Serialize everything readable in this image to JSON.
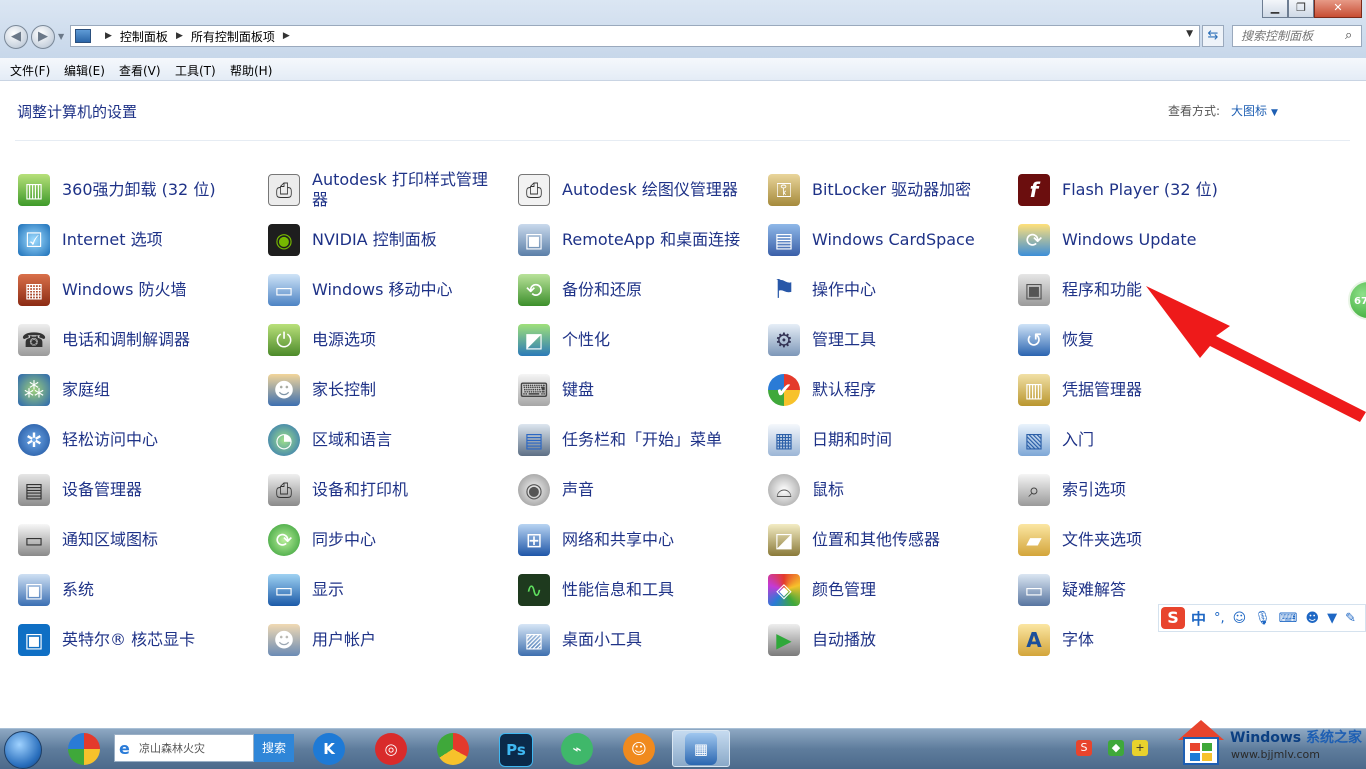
{
  "window": {
    "breadcrumb": [
      "控制面板",
      "所有控制面板项"
    ],
    "search_placeholder": "搜索控制面板",
    "controls": [
      "minimize",
      "maximize",
      "close"
    ]
  },
  "menu": [
    "文件(F)",
    "编辑(E)",
    "查看(V)",
    "工具(T)",
    "帮助(H)"
  ],
  "content": {
    "heading": "调整计算机的设置",
    "view_by_label": "查看方式:",
    "view_by_value": "大图标"
  },
  "items": [
    {
      "label": "360强力卸载 (32 位)",
      "icon": "uninstall-icon"
    },
    {
      "label": "Autodesk 打印样式管理器",
      "icon": "printer-style-icon"
    },
    {
      "label": "Autodesk 绘图仪管理器",
      "icon": "plotter-icon"
    },
    {
      "label": "BitLocker 驱动器加密",
      "icon": "bitlocker-icon"
    },
    {
      "label": "Flash Player (32 位)",
      "icon": "flash-icon"
    },
    {
      "label": "Internet 选项",
      "icon": "internet-options-icon"
    },
    {
      "label": "NVIDIA 控制面板",
      "icon": "nvidia-icon"
    },
    {
      "label": "RemoteApp 和桌面连接",
      "icon": "remoteapp-icon"
    },
    {
      "label": "Windows CardSpace",
      "icon": "cardspace-icon"
    },
    {
      "label": "Windows Update",
      "icon": "windows-update-icon"
    },
    {
      "label": "Windows 防火墙",
      "icon": "firewall-icon"
    },
    {
      "label": "Windows 移动中心",
      "icon": "mobility-center-icon"
    },
    {
      "label": "备份和还原",
      "icon": "backup-icon"
    },
    {
      "label": "操作中心",
      "icon": "action-center-flag-icon"
    },
    {
      "label": "程序和功能",
      "icon": "programs-features-icon"
    },
    {
      "label": "电话和调制解调器",
      "icon": "phone-modem-icon"
    },
    {
      "label": "电源选项",
      "icon": "power-icon"
    },
    {
      "label": "个性化",
      "icon": "personalization-icon"
    },
    {
      "label": "管理工具",
      "icon": "admin-tools-icon"
    },
    {
      "label": "恢复",
      "icon": "recovery-icon"
    },
    {
      "label": "家庭组",
      "icon": "homegroup-icon"
    },
    {
      "label": "家长控制",
      "icon": "parental-control-icon"
    },
    {
      "label": "键盘",
      "icon": "keyboard-icon"
    },
    {
      "label": "默认程序",
      "icon": "default-programs-icon"
    },
    {
      "label": "凭据管理器",
      "icon": "credential-manager-icon"
    },
    {
      "label": "轻松访问中心",
      "icon": "ease-of-access-icon"
    },
    {
      "label": "区域和语言",
      "icon": "region-language-icon"
    },
    {
      "label": "任务栏和「开始」菜单",
      "icon": "taskbar-start-icon"
    },
    {
      "label": "日期和时间",
      "icon": "date-time-icon"
    },
    {
      "label": "入门",
      "icon": "getting-started-icon"
    },
    {
      "label": "设备管理器",
      "icon": "device-manager-icon"
    },
    {
      "label": "设备和打印机",
      "icon": "devices-printers-icon"
    },
    {
      "label": "声音",
      "icon": "sound-icon"
    },
    {
      "label": "鼠标",
      "icon": "mouse-icon"
    },
    {
      "label": "索引选项",
      "icon": "indexing-icon"
    },
    {
      "label": "通知区域图标",
      "icon": "notification-area-icon"
    },
    {
      "label": "同步中心",
      "icon": "sync-center-icon"
    },
    {
      "label": "网络和共享中心",
      "icon": "network-sharing-icon"
    },
    {
      "label": "位置和其他传感器",
      "icon": "location-sensors-icon"
    },
    {
      "label": "文件夹选项",
      "icon": "folder-options-icon"
    },
    {
      "label": "系统",
      "icon": "system-icon"
    },
    {
      "label": "显示",
      "icon": "display-icon"
    },
    {
      "label": "性能信息和工具",
      "icon": "performance-icon"
    },
    {
      "label": "颜色管理",
      "icon": "color-management-icon"
    },
    {
      "label": "疑难解答",
      "icon": "troubleshooting-icon"
    },
    {
      "label": "英特尔® 核芯显卡",
      "icon": "intel-graphics-icon"
    },
    {
      "label": "用户帐户",
      "icon": "user-accounts-icon"
    },
    {
      "label": "桌面小工具",
      "icon": "gadgets-icon"
    },
    {
      "label": "自动播放",
      "icon": "autoplay-icon"
    },
    {
      "label": "字体",
      "icon": "fonts-icon"
    }
  ],
  "side_bubble": "67",
  "ime": {
    "logo": "S",
    "mode": "中"
  },
  "taskbar": {
    "search_text": "凉山森林火灾",
    "search_button": "搜索"
  },
  "watermark": {
    "brand": "Windows",
    "brand_cn": "系统之家",
    "url": "www.bjjmlv.com"
  }
}
